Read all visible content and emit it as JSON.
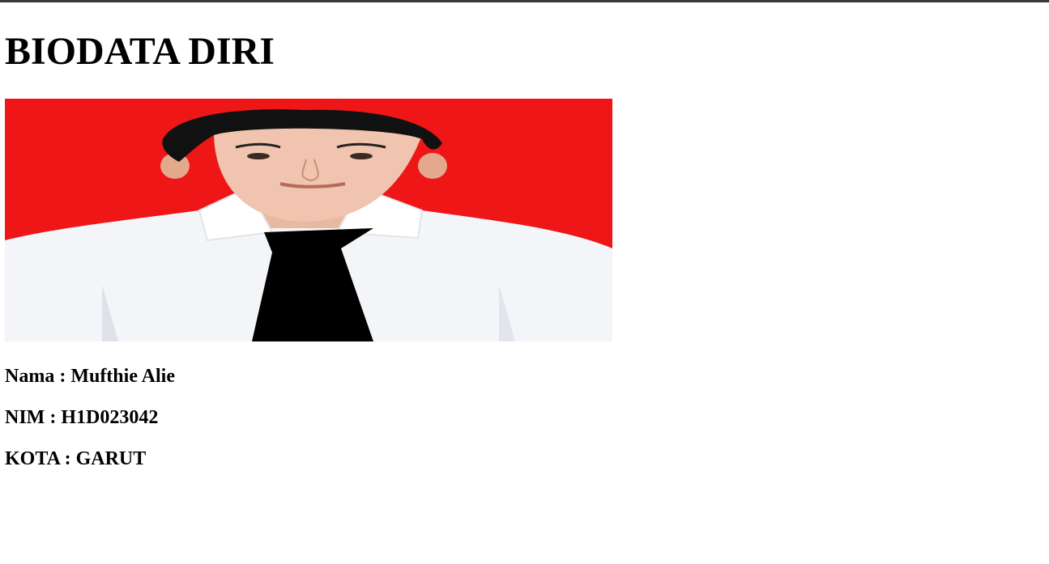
{
  "page": {
    "title": "BIODATA DIRI"
  },
  "photo": {
    "description_icon": "portrait-photo",
    "background_color": "#ee1616"
  },
  "info": {
    "name_line": "Nama : Mufthie Alie",
    "nim_line": "NIM : H1D023042",
    "kota_line": "KOTA : GARUT"
  }
}
